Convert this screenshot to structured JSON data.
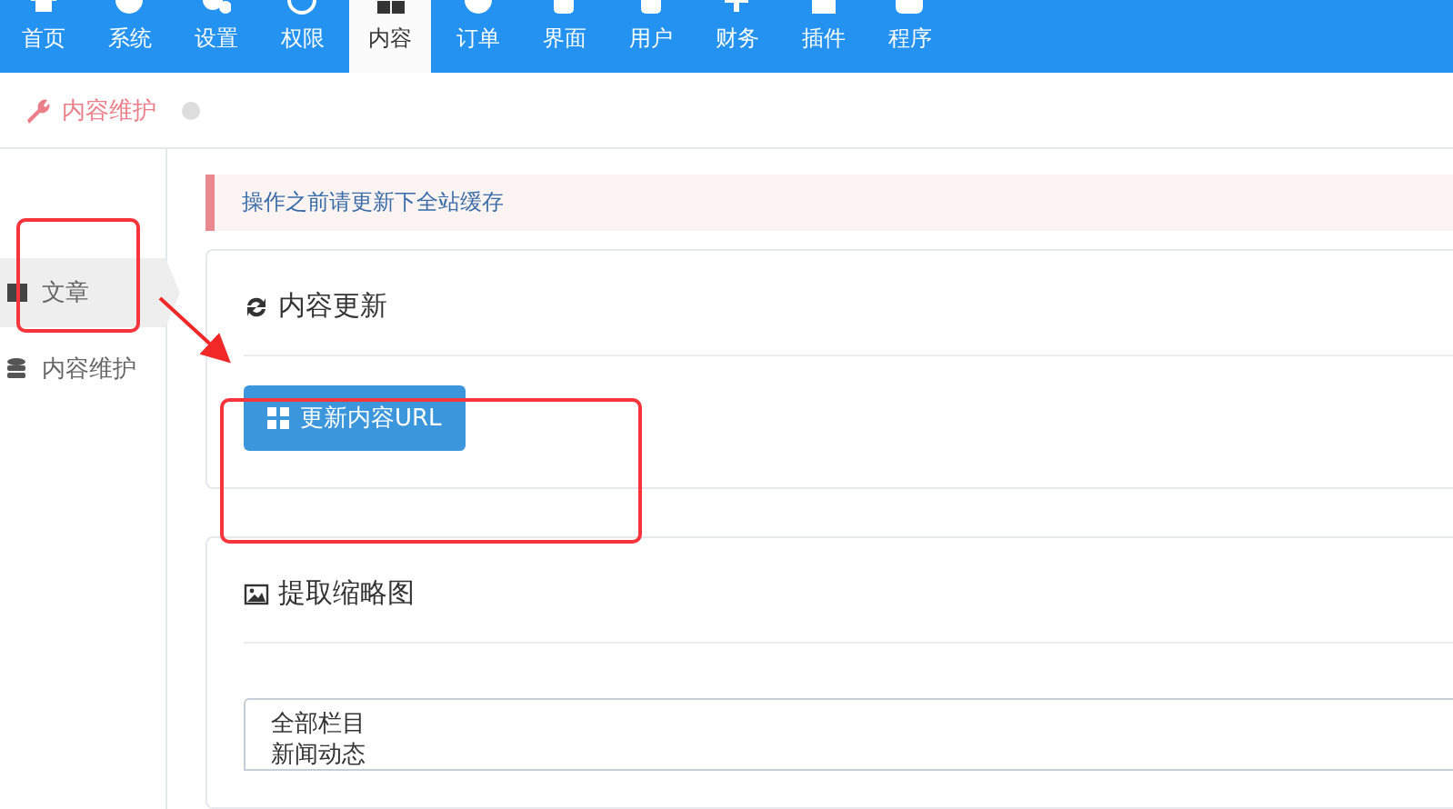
{
  "nav": {
    "items": [
      {
        "label": "首页",
        "selected": false
      },
      {
        "label": "系统",
        "selected": false
      },
      {
        "label": "设置",
        "selected": false
      },
      {
        "label": "权限",
        "selected": false
      },
      {
        "label": "内容",
        "selected": true
      },
      {
        "label": "订单",
        "selected": false
      },
      {
        "label": "界面",
        "selected": false
      },
      {
        "label": "用户",
        "selected": false
      },
      {
        "label": "财务",
        "selected": false
      },
      {
        "label": "插件",
        "selected": false
      },
      {
        "label": "程序",
        "selected": false
      }
    ]
  },
  "breadcrumb": {
    "title": "内容维护"
  },
  "sidebar": {
    "items": [
      {
        "label": "文章",
        "kind": "book",
        "selected": true
      },
      {
        "label": "内容维护",
        "kind": "database",
        "selected": false
      }
    ]
  },
  "alert": {
    "text": "操作之前请更新下全站缓存"
  },
  "panels": [
    {
      "title": "内容更新",
      "kind": "refresh",
      "button": "更新内容URL"
    },
    {
      "title": "提取缩略图",
      "kind": "image",
      "options": [
        "全部栏目",
        "新闻动态"
      ]
    }
  ]
}
